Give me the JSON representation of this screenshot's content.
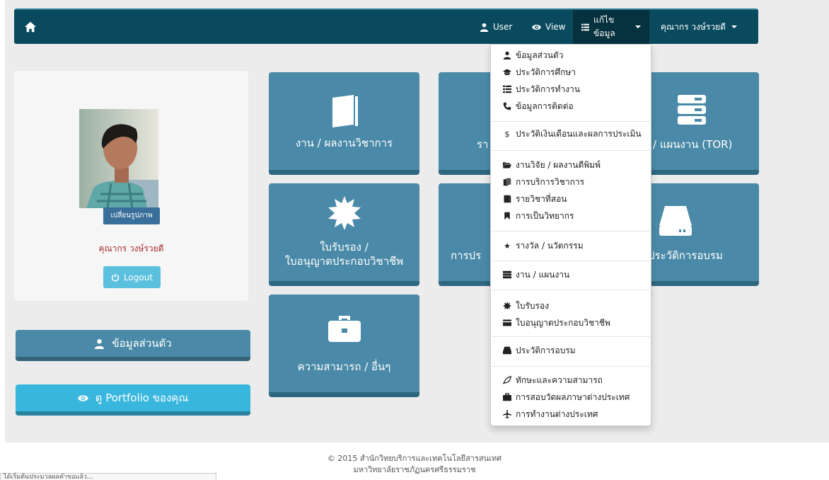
{
  "navbar": {
    "home_icon": "home-icon",
    "user_label": "User",
    "view_label": "View",
    "edit_label": "แก้ไขข้อมูล",
    "name_label": "คุณากร วงษ์รวยดี"
  },
  "profile": {
    "change_photo_label": "เปลี่ยนรูปภาพ",
    "name": "คุณากร วงษ์รวยดี",
    "logout_label": "Logout"
  },
  "side_buttons": {
    "personal_label": "ข้อมูลส่วนตัว",
    "portfolio_label": "ดู Portfolio ของคุณ"
  },
  "tiles": {
    "academic": "งาน / ผลงานวิชาการ",
    "course_partial": "รา",
    "plan": "/ แผนงาน (TOR)",
    "license_line1": "ใบรับรอง /",
    "license_line2": "ใบอนุญาตประกอบวิชาชีพ",
    "assess_partial": "การปร",
    "training_partial": "ประวัติการอบรม",
    "skills": "ความสามารถ / อื่นๆ"
  },
  "dropdown": {
    "items": [
      {
        "label": "ข้อมูลส่วนตัว",
        "icon": "user-icon"
      },
      {
        "label": "ประวัติการศึกษา",
        "icon": "graduation-cap-icon"
      },
      {
        "label": "ประวัติการทำงาน",
        "icon": "list-icon"
      },
      {
        "label": "ข้อมูลการติดต่อ",
        "icon": "phone-icon"
      },
      {
        "label": "ประวัติเงินเดือนและผลการประเมิน",
        "icon": "dollar-icon"
      },
      {
        "label": "งานวิจัย / ผลงานตีพิมพ์",
        "icon": "folder-open-icon"
      },
      {
        "label": "การบริการวิชาการ",
        "icon": "files-icon"
      },
      {
        "label": "รายวิชาที่สอน",
        "icon": "book-icon"
      },
      {
        "label": "การเป็นวิทยากร",
        "icon": "bookmark-icon"
      },
      {
        "label": "รางวัล / นวัตกรรม",
        "icon": "star-icon"
      },
      {
        "label": "งาน / แผนงาน",
        "icon": "tasks-icon"
      },
      {
        "label": "ใบรับรอง",
        "icon": "certificate-icon"
      },
      {
        "label": "ใบอนุญาตประกอบวิชาชีพ",
        "icon": "credit-card-icon"
      },
      {
        "label": "ประวัติการอบรม",
        "icon": "hdd-icon"
      },
      {
        "label": "ทักษะและความสามารถ",
        "icon": "leaf-icon"
      },
      {
        "label": "การสอบวัดผลภาษาต่างประเทศ",
        "icon": "briefcase-icon"
      },
      {
        "label": "การทำงานต่างประเทศ",
        "icon": "plane-icon"
      }
    ]
  },
  "footer": {
    "line1": "© 2015 สำนักวิทยบริการและเทคโนโลยีสารสนเทศ",
    "line2": "มหาวิทยาลัยราชภัฏนครศรีธรรมราช"
  },
  "status_bar": "ได้เริ่มต้นประมวลผลคำขอแล้ว..."
}
